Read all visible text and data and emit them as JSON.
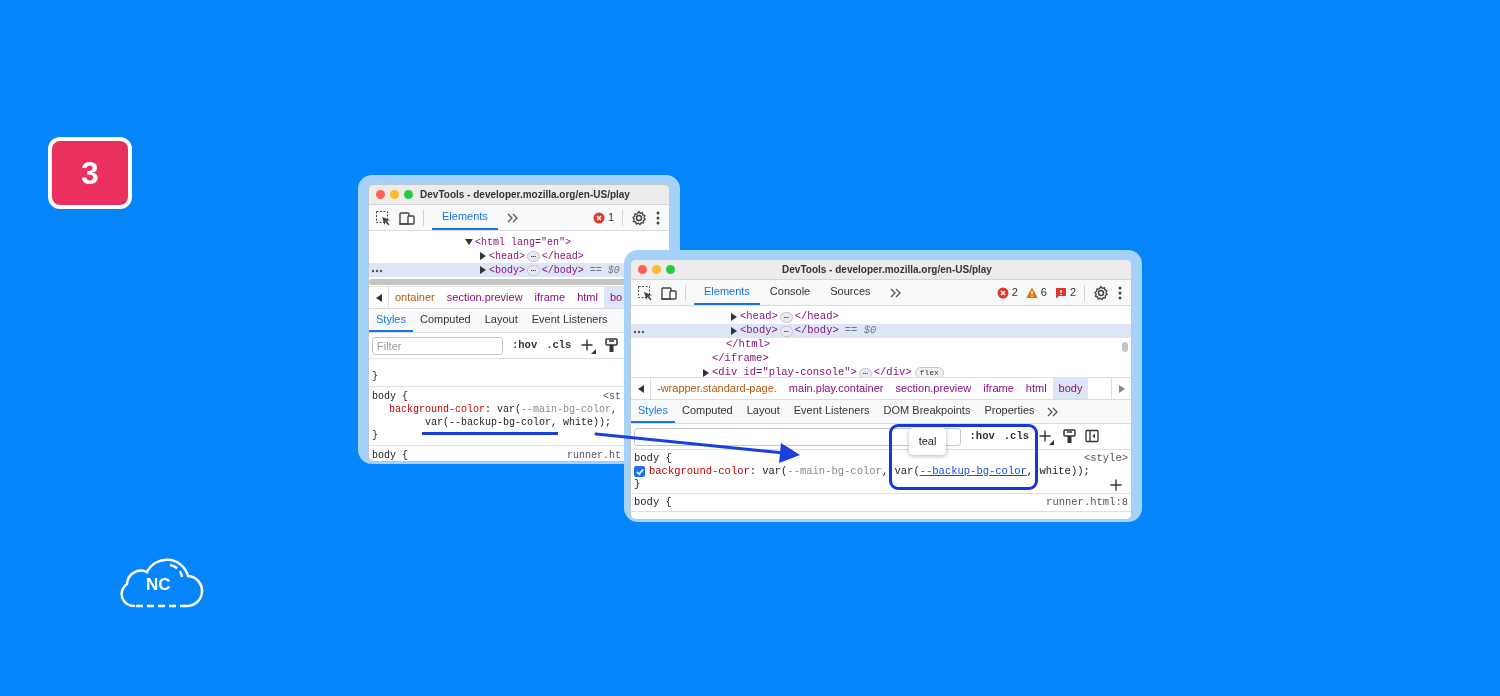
{
  "badge": "3",
  "logo": {
    "text": "NC"
  },
  "windows": [
    {
      "title": "DevTools - developer.mozilla.org/en-US/play",
      "toolbar_tabs": [
        {
          "label": "Elements",
          "selected": true
        }
      ],
      "more_tabs": true,
      "counters": [
        {
          "kind": "error",
          "count": "1"
        }
      ],
      "dom_tree": [
        {
          "open": "<html lang=\"en\">",
          "expanded": true,
          "selected": false,
          "children": [
            {
              "open": "<head>",
              "pill": "⋯",
              "close": "</head>",
              "expanded": false,
              "selected": false
            },
            {
              "open": "<body>",
              "pill": "⋯",
              "close": "</body>",
              "suffix": "== $0",
              "expanded": false,
              "selected": true
            }
          ]
        }
      ],
      "breadcrumbs": {
        "scroll_left": true,
        "items": [
          {
            "label": "ontainer",
            "faded": true,
            "selected": false
          },
          {
            "label": "section.preview",
            "faded": false,
            "selected": false
          },
          {
            "label": "iframe",
            "faded": false,
            "selected": false
          },
          {
            "label": "html",
            "faded": false,
            "selected": false
          },
          {
            "label": "bo",
            "faded": false,
            "selected": true
          }
        ]
      },
      "panel_tabs": [
        {
          "label": "Styles",
          "selected": true
        },
        {
          "label": "Computed",
          "selected": false
        },
        {
          "label": "Layout",
          "selected": false
        },
        {
          "label": "Event Listeners",
          "selected": false
        }
      ],
      "filter": {
        "placeholder": "Filter"
      },
      "toggles": [
        ":hov",
        ".cls"
      ],
      "tools": [
        {
          "kind": "new-rule"
        },
        {
          "kind": "paint"
        }
      ],
      "rules": [
        {
          "close": "}"
        },
        {
          "selector": "body {",
          "source": "<st",
          "declarations": [
            {
              "property": "background-color",
              "separator": ":",
              "lines": [
                [
                  {
                    "text": "var(",
                    "kind": "plain"
                  },
                  {
                    "text": "--main-bg-color",
                    "kind": "muted"
                  },
                  {
                    "text": ",",
                    "kind": "plain"
                  }
                ],
                [
                  {
                    "text": "var(--backup-bg-color, white));",
                    "kind": "plain"
                  }
                ]
              ]
            }
          ],
          "close": "}"
        },
        {
          "selector": "body {",
          "source": "runner.ht"
        }
      ]
    },
    {
      "title": "DevTools - developer.mozilla.org/en-US/play",
      "toolbar_tabs": [
        {
          "label": "Elements",
          "selected": true
        },
        {
          "label": "Console",
          "selected": false
        },
        {
          "label": "Sources",
          "selected": false
        }
      ],
      "more_tabs": true,
      "counters": [
        {
          "kind": "error",
          "count": "2"
        },
        {
          "kind": "warning",
          "count": "6"
        },
        {
          "kind": "issue",
          "count": "2"
        }
      ],
      "dom_tree": [
        {
          "close": "</iframe>",
          "children": [
            {
              "close": "</html>",
              "children": [
                {
                  "open": "<head>",
                  "pill": "⋯",
                  "close": "</head>",
                  "expanded": false,
                  "selected": false
                },
                {
                  "open": "<body>",
                  "pill": "⋯",
                  "close": "</body>",
                  "suffix": "== $0",
                  "expanded": false,
                  "selected": true
                }
              ]
            }
          ]
        },
        {
          "open": "<div id=\"play-console\">",
          "pill": "⋯",
          "close": "</div>",
          "badge": "flex",
          "expanded": false,
          "selected": false
        }
      ],
      "breadcrumbs": {
        "scroll_left": true,
        "scroll_right": true,
        "items": [
          {
            "label": "-wrapper.standard-page.",
            "faded": true,
            "selected": false
          },
          {
            "label": "main.play.container",
            "faded": false,
            "selected": false
          },
          {
            "label": "section.preview",
            "faded": false,
            "selected": false
          },
          {
            "label": "iframe",
            "faded": false,
            "selected": false
          },
          {
            "label": "html",
            "faded": false,
            "selected": false
          },
          {
            "label": "body",
            "faded": false,
            "selected": true
          }
        ]
      },
      "panel_tabs": [
        {
          "label": "Styles",
          "selected": true
        },
        {
          "label": "Computed",
          "selected": false
        },
        {
          "label": "Layout",
          "selected": false
        },
        {
          "label": "Event Listeners",
          "selected": false
        },
        {
          "label": "DOM Breakpoints",
          "selected": false
        },
        {
          "label": "Properties",
          "selected": false
        }
      ],
      "more_panel_tabs": true,
      "toggles": [
        ":hov",
        ".cls"
      ],
      "tools": [
        {
          "kind": "new-rule"
        },
        {
          "kind": "paint"
        },
        {
          "kind": "sidebar"
        }
      ],
      "rules": [
        {
          "selector": "body {",
          "source": "<style>",
          "declarations": [
            {
              "checked": true,
              "property": "background-color",
              "separator": ":",
              "lines": [
                [
                  {
                    "text": "var(",
                    "kind": "plain"
                  },
                  {
                    "text": "--main-bg-color",
                    "kind": "muted"
                  },
                  {
                    "text": ", var(",
                    "kind": "plain"
                  },
                  {
                    "text": "--backup-bg-color",
                    "kind": "link"
                  },
                  {
                    "text": ", white));",
                    "kind": "plain"
                  }
                ]
              ]
            }
          ],
          "close": "}",
          "add_button": true
        },
        {
          "selector": "body {",
          "source": "runner.html:8"
        }
      ]
    }
  ],
  "tooltip": {
    "text": "teal"
  }
}
